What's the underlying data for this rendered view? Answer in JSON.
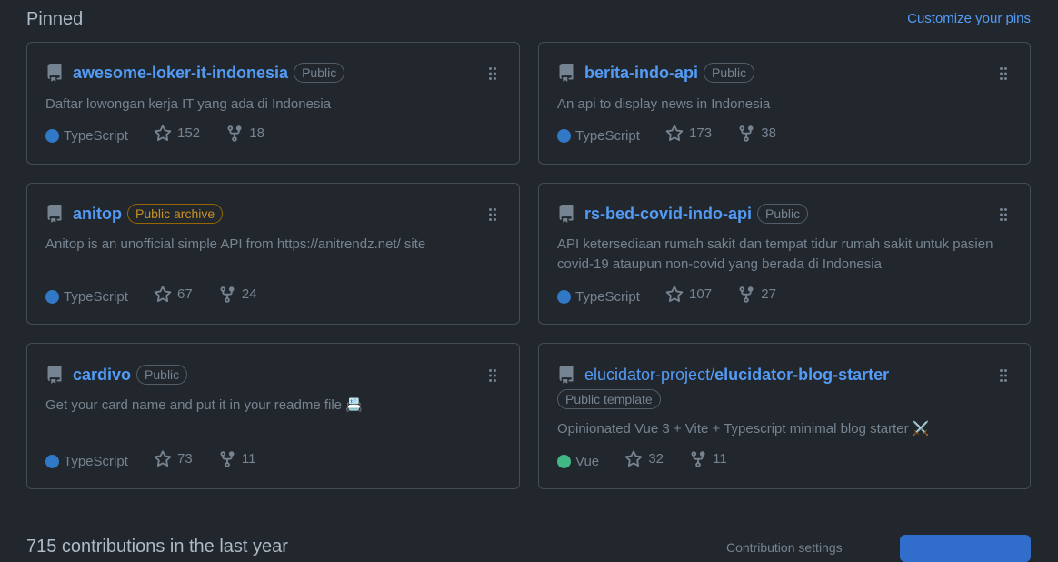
{
  "header": {
    "title": "Pinned",
    "customize_label": "Customize your pins"
  },
  "cards": [
    {
      "owner": "",
      "name": "awesome-loker-it-indonesia",
      "badge": "Public",
      "description": "Daftar lowongan kerja IT yang ada di Indonesia",
      "language": "TypeScript",
      "language_color": "#3178c6",
      "stars": "152",
      "forks": "18"
    },
    {
      "owner": "",
      "name": "berita-indo-api",
      "badge": "Public",
      "description": "An api to display news in Indonesia",
      "language": "TypeScript",
      "language_color": "#3178c6",
      "stars": "173",
      "forks": "38"
    },
    {
      "owner": "",
      "name": "anitop",
      "badge": "Public archive",
      "description": "Anitop is an unofficial simple API from https://anitrendz.net/ site",
      "language": "TypeScript",
      "language_color": "#3178c6",
      "stars": "67",
      "forks": "24"
    },
    {
      "owner": "",
      "name": "rs-bed-covid-indo-api",
      "badge": "Public",
      "description": "API ketersediaan rumah sakit dan tempat tidur rumah sakit untuk pasien covid-19 ataupun non-covid yang berada di Indonesia",
      "language": "TypeScript",
      "language_color": "#3178c6",
      "stars": "107",
      "forks": "27"
    },
    {
      "owner": "",
      "name": "cardivo",
      "badge": "Public",
      "description": "Get your card name and put it in your readme file 📇",
      "language": "TypeScript",
      "language_color": "#3178c6",
      "stars": "73",
      "forks": "11"
    },
    {
      "owner": "elucidator-project/",
      "name": "elucidator-blog-starter",
      "badge": "Public template",
      "description": "Opinionated Vue 3 + Vite + Typescript minimal blog starter ⚔️",
      "language": "Vue",
      "language_color": "#41b883",
      "stars": "32",
      "forks": "11"
    }
  ],
  "contributions": {
    "summary": "715 contributions in the last year",
    "settings_label": "Contribution settings"
  },
  "colors": {
    "background": "#22272e",
    "border": "#444c56",
    "link": "#539bf5",
    "muted": "#768390",
    "archive": "#c69026"
  }
}
